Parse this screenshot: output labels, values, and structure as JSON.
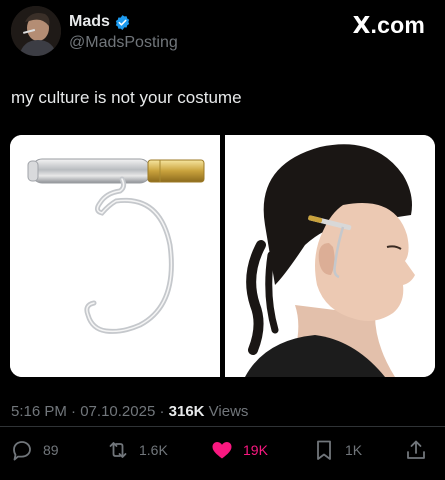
{
  "user": {
    "display_name": "Mads",
    "handle": "@MadsPosting",
    "avatar_icon": "profile-photo",
    "verified_icon": "verified-badge-icon"
  },
  "brand": {
    "x_mark": "X",
    "suffix": ".com"
  },
  "tweet": {
    "text": "my culture is not your costume"
  },
  "media": [
    {
      "alt_icon": "ear-cuff-jewelry-photo"
    },
    {
      "alt_icon": "model-wearing-ear-cuff-photo"
    }
  ],
  "meta": {
    "time": "5:16 PM",
    "sep1": " · ",
    "date": "07.10.2025",
    "sep2": " · ",
    "views_count": "316K",
    "views_label": " Views"
  },
  "actions": {
    "replies": "89",
    "reposts": "1.6K",
    "likes": "19K",
    "bookmarks": "1K"
  },
  "colors": {
    "background": "#000000",
    "text": "#e7e9ea",
    "secondary": "#71767b",
    "like": "#f91880",
    "verified": "#1d9bf0"
  }
}
